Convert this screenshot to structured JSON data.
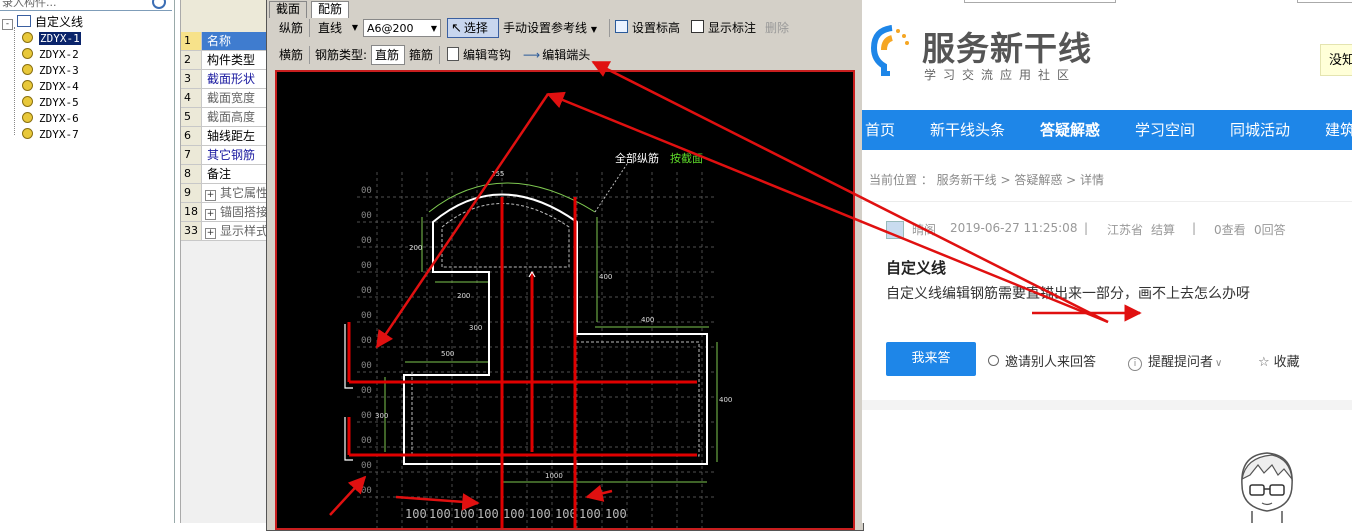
{
  "tree": {
    "search_placeholder": "录入构件...",
    "root_label": "自定义线",
    "items": [
      "ZDYX-1",
      "ZDYX-2",
      "ZDYX-3",
      "ZDYX-4",
      "ZDYX-5",
      "ZDYX-6",
      "ZDYX-7"
    ]
  },
  "props": {
    "rows": [
      {
        "num": "1",
        "name": "名称"
      },
      {
        "num": "2",
        "name": "构件类型"
      },
      {
        "num": "3",
        "name": "截面形状"
      },
      {
        "num": "4",
        "name": "截面宽度"
      },
      {
        "num": "5",
        "name": "截面高度"
      },
      {
        "num": "6",
        "name": "轴线距左"
      },
      {
        "num": "7",
        "name": "其它钢筋"
      },
      {
        "num": "8",
        "name": "备注"
      },
      {
        "num": "9",
        "name": "其它属性"
      },
      {
        "num": "18",
        "name": "锚固搭接"
      },
      {
        "num": "33",
        "name": "显示样式"
      }
    ]
  },
  "dialog": {
    "tabs": [
      "截面",
      "配筋"
    ],
    "toolbar1": {
      "longitudinal": "纵筋",
      "shape_value": "直线",
      "spec_value": "A6@200",
      "select": "选择",
      "manual_ref": "手动设置参考线",
      "set_elevation": "设置标高",
      "show_annotation": "显示标注",
      "delete": "删除"
    },
    "toolbar2": {
      "transverse": "横筋",
      "rebar_type_label": "钢筋类型:",
      "straight": "直筋",
      "stirrup": "箍筋",
      "edit_bend": "编辑弯钩",
      "edit_end": "编辑端头"
    },
    "canvas": {
      "all_long_label": "全部纵筋",
      "by_section": "按截面",
      "dims": [
        "155",
        "200",
        "200",
        "300",
        "500",
        "400",
        "400",
        "300",
        "400",
        "1000"
      ],
      "grid_left": "100",
      "grid_bottom": "100"
    }
  },
  "web": {
    "brand": "服务新干线",
    "slogan": "学习交流应用社区",
    "notice": "没知",
    "nav": [
      "首页",
      "新干线头条",
      "答疑解惑",
      "学习空间",
      "同城活动",
      "建筑"
    ],
    "breadcrumb": "当前位置 ： 服务新干线 > 答疑解惑 > 详情",
    "meta": {
      "user": "晴阁",
      "time": "2019-06-27 11:25:08",
      "location": "江苏省",
      "category": "结算",
      "views": "0查看",
      "answers": "0回答"
    },
    "question_title": "自定义线",
    "question_body": "自定义线编辑钢筋需要直锚出来一部分，画不上去怎么办呀",
    "answer_button": "我来答",
    "invite": "邀请别人来回答",
    "remind": "提醒提问者",
    "favorite": "收藏"
  },
  "colors": {
    "nav_blue": "#1e86e8",
    "annotation_red": "#e01010",
    "cad_bg": "#000000",
    "rebar_red": "#e00000",
    "dim_green": "#7ec850"
  }
}
